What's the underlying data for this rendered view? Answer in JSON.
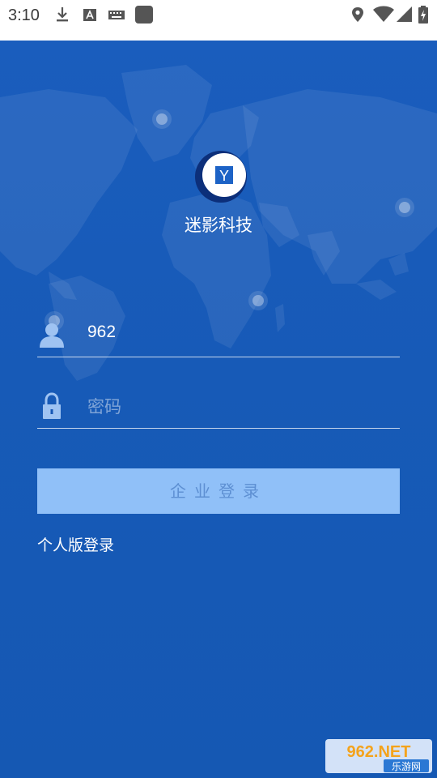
{
  "status_bar": {
    "time": "3:10",
    "icons": [
      "download-icon",
      "font-a-icon",
      "keyboard-icon",
      "app-square-icon",
      "location-icon",
      "wifi-icon",
      "signal-icon",
      "battery-charging-icon"
    ]
  },
  "brand": {
    "logo_letter": "Y",
    "name": "迷影科技"
  },
  "username_field": {
    "icon": "user-icon",
    "value": "962"
  },
  "password_field": {
    "icon": "lock-icon",
    "placeholder": "密码"
  },
  "login_button": {
    "label": "企业登录"
  },
  "personal_login_link": {
    "label": "个人版登录"
  },
  "watermark": {
    "top": "962.NET",
    "bottom": "乐游网"
  },
  "colors": {
    "background": "#1657b5",
    "button_bg": "#90c0f8",
    "button_text": "#5d8fd2"
  }
}
